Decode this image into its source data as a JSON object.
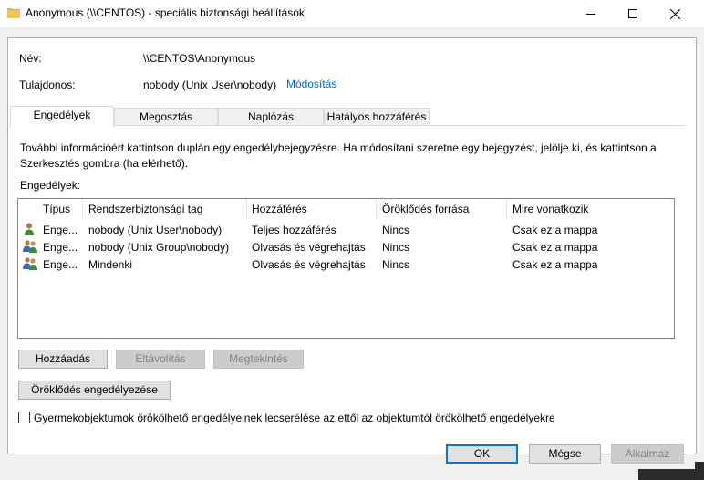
{
  "window": {
    "title": "Anonymous (\\\\CENTOS) - speciális biztonsági beállítások",
    "folder_icon": "folder-icon"
  },
  "fields": {
    "name_label": "Név:",
    "name_value": "\\\\CENTOS\\Anonymous",
    "owner_label": "Tulajdonos:",
    "owner_value": "nobody (Unix User\\nobody)",
    "change_link": "Módosítás"
  },
  "tabs": [
    {
      "label": "Engedélyek",
      "active": true
    },
    {
      "label": "Megosztás",
      "active": false
    },
    {
      "label": "Naplózás",
      "active": false
    },
    {
      "label": "Hatályos hozzáférés",
      "active": false
    }
  ],
  "description": "További információért kattintson duplán egy engedélybejegyzésre. Ha módosítani szeretne egy bejegyzést, jelölje ki, és kattintson a Szerkesztés gombra (ha elérhető).",
  "permissions_label": "Engedélyek:",
  "columns": [
    "Típus",
    "Rendszerbiztonsági tag",
    "Hozzáférés",
    "Öröklődés forrása",
    "Mire vonatkozik"
  ],
  "rows": [
    {
      "icon": "user-icon",
      "type": "Enge...",
      "principal": "nobody (Unix User\\nobody)",
      "access": "Teljes hozzáférés",
      "inherited": "Nincs",
      "applies": "Csak ez a mappa"
    },
    {
      "icon": "group-icon",
      "type": "Enge...",
      "principal": "nobody (Unix Group\\nobody)",
      "access": "Olvasás és végrehajtás",
      "inherited": "Nincs",
      "applies": "Csak ez a mappa"
    },
    {
      "icon": "group-icon",
      "type": "Enge...",
      "principal": "Mindenki",
      "access": "Olvasás és végrehajtás",
      "inherited": "Nincs",
      "applies": "Csak ez a mappa"
    }
  ],
  "buttons": {
    "add": "Hozzáadás",
    "remove": "Eltávolítás",
    "view": "Megtekintés",
    "enable_inheritance": "Öröklődés engedélyezése",
    "ok": "OK",
    "cancel": "Mégse",
    "apply": "Alkalmaz"
  },
  "checkbox_label": "Gyermekobjektumok örökölhető engedélyeinek lecserélése az ettől az objektumtól örökölhető engedélyekre",
  "checkbox_checked": false
}
